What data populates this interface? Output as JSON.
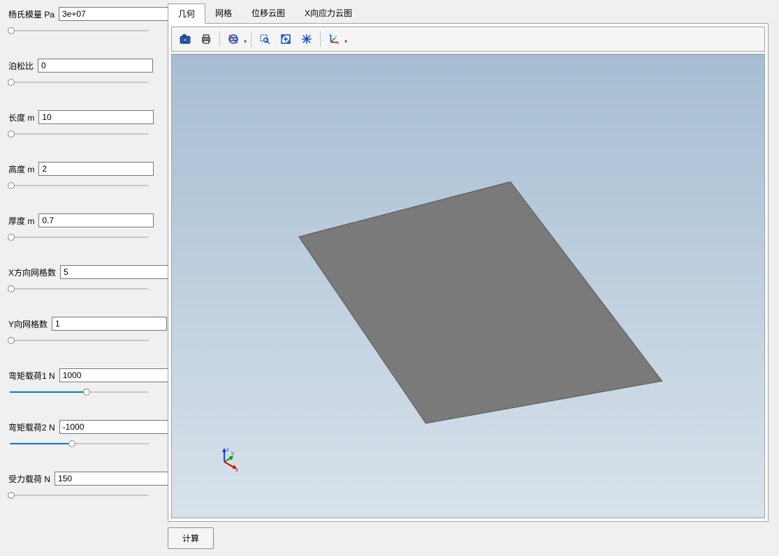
{
  "sidebar": {
    "params": [
      {
        "label": "杨氏模量 Pa",
        "value": "3e+07",
        "fill": 0,
        "thumb": 2
      },
      {
        "label": "泊松比",
        "value": "0",
        "fill": 0,
        "thumb": 2
      },
      {
        "label": "长度 m",
        "value": "10",
        "fill": 0,
        "thumb": 2
      },
      {
        "label": "高度 m",
        "value": "2",
        "fill": 0,
        "thumb": 2
      },
      {
        "label": "厚度 m",
        "value": "0.7",
        "fill": 0,
        "thumb": 2
      },
      {
        "label": "X方向网格数",
        "value": "5",
        "fill": 0,
        "thumb": 2
      },
      {
        "label": "Y向网格数",
        "value": "1",
        "fill": 0,
        "thumb": 2
      },
      {
        "label": "弯矩载荷1 N",
        "value": "1000",
        "fill": 55,
        "thumb": 55
      },
      {
        "label": "弯矩载荷2 N",
        "value": "-1000",
        "fill": 45,
        "thumb": 45
      },
      {
        "label": "受力载荷 N",
        "value": "150",
        "fill": 0,
        "thumb": 2
      }
    ]
  },
  "tabs": {
    "items": [
      "几何",
      "网格",
      "位移云图",
      "X向应力云图"
    ],
    "active": 0
  },
  "toolbar": {
    "icons": [
      "camera-icon",
      "printer-icon",
      "sep",
      "sphere-icon",
      "dd",
      "sep",
      "zoom-box-icon",
      "fit-screen-icon",
      "rotate-icon",
      "sep",
      "axes-icon",
      "dd"
    ]
  },
  "triad": {
    "x": "x",
    "y": "y",
    "z": "z"
  },
  "buttons": {
    "calculate": "计算"
  }
}
